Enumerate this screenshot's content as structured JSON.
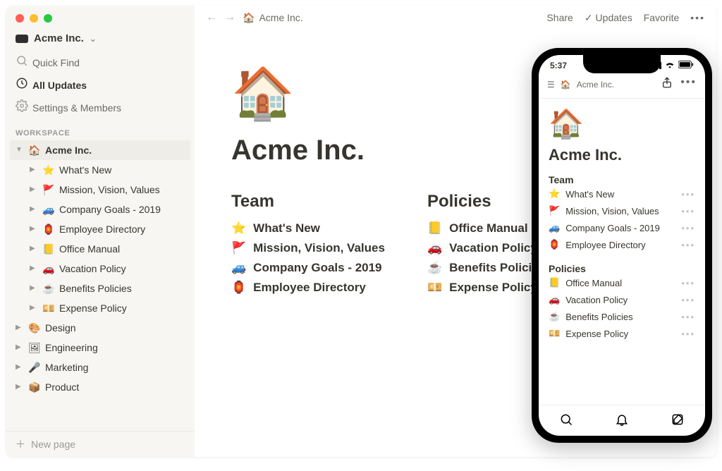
{
  "traffic_lights": [
    "red",
    "yellow",
    "green"
  ],
  "workspace": {
    "name": "Acme Inc."
  },
  "sidebar_nav": {
    "quick_find": "Quick Find",
    "all_updates": "All Updates",
    "settings": "Settings & Members"
  },
  "section_label": "WORKSPACE",
  "tree": {
    "root": {
      "emoji": "🏠",
      "label": "Acme Inc."
    },
    "children": [
      {
        "emoji": "⭐️",
        "label": "What's New"
      },
      {
        "emoji": "🚩",
        "label": "Mission, Vision, Values"
      },
      {
        "emoji": "🚙",
        "label": "Company Goals - 2019"
      },
      {
        "emoji": "🏮",
        "label": "Employee Directory"
      },
      {
        "emoji": "📒",
        "label": "Office Manual"
      },
      {
        "emoji": "🚗",
        "label": "Vacation Policy"
      },
      {
        "emoji": "☕️",
        "label": "Benefits Policies"
      },
      {
        "emoji": "💴",
        "label": "Expense Policy"
      }
    ],
    "siblings": [
      {
        "emoji": "🎨",
        "label": "Design"
      },
      {
        "emoji": "🖼",
        "label": "Engineering"
      },
      {
        "emoji": "🎤",
        "label": "Marketing"
      },
      {
        "emoji": "📦",
        "label": "Product"
      }
    ]
  },
  "new_page": "New page",
  "topbar": {
    "breadcrumb_emoji": "🏠",
    "breadcrumb": "Acme Inc.",
    "share": "Share",
    "updates": "Updates",
    "favorite": "Favorite",
    "more": "•••"
  },
  "page": {
    "emoji": "🏠",
    "title": "Acme Inc.",
    "sections": [
      {
        "heading": "Team",
        "links": [
          {
            "emoji": "⭐️",
            "label": "What's New"
          },
          {
            "emoji": "🚩",
            "label": "Mission, Vision, Values"
          },
          {
            "emoji": "🚙",
            "label": "Company Goals - 2019"
          },
          {
            "emoji": "🏮",
            "label": "Employee Directory"
          }
        ]
      },
      {
        "heading": "Policies",
        "links": [
          {
            "emoji": "📒",
            "label": "Office Manual"
          },
          {
            "emoji": "🚗",
            "label": "Vacation Policy"
          },
          {
            "emoji": "☕️",
            "label": "Benefits Policies"
          },
          {
            "emoji": "💴",
            "label": "Expense Policy"
          }
        ]
      }
    ]
  },
  "mobile": {
    "time": "5:37",
    "breadcrumb_emoji": "🏠",
    "breadcrumb": "Acme Inc.",
    "emoji": "🏠",
    "title": "Acme Inc.",
    "sections": [
      {
        "heading": "Team",
        "links": [
          {
            "emoji": "⭐️",
            "label": "What's New"
          },
          {
            "emoji": "🚩",
            "label": "Mission, Vision, Values"
          },
          {
            "emoji": "🚙",
            "label": "Company Goals - 2019"
          },
          {
            "emoji": "🏮",
            "label": "Employee Directory"
          }
        ]
      },
      {
        "heading": "Policies",
        "links": [
          {
            "emoji": "📒",
            "label": "Office Manual"
          },
          {
            "emoji": "🚗",
            "label": "Vacation Policy"
          },
          {
            "emoji": "☕️",
            "label": "Benefits Policies"
          },
          {
            "emoji": "💴",
            "label": "Expense Policy"
          }
        ]
      }
    ]
  }
}
